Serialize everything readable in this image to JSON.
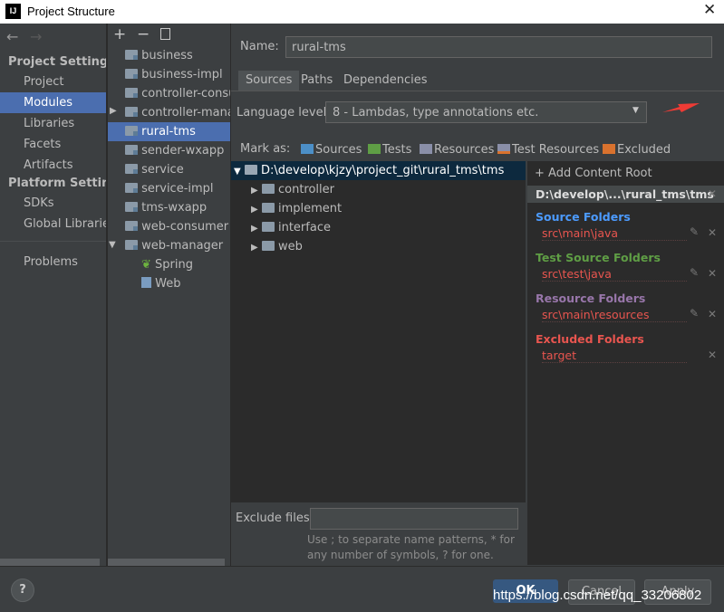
{
  "window": {
    "title": "Project Structure",
    "logo_text": "IJ"
  },
  "nav": {
    "project_settings": "Project Settings",
    "project_items": [
      "Project",
      "Modules",
      "Libraries",
      "Facets",
      "Artifacts"
    ],
    "platform_settings": "Platform Settings",
    "platform_items": [
      "SDKs",
      "Global Libraries"
    ],
    "problems": "Problems",
    "selected": "Modules"
  },
  "modules": {
    "items": [
      "business",
      "business-impl",
      "controller-consumer",
      "controller-manager",
      "rural-tms",
      "sender-wxapp",
      "service",
      "service-impl",
      "tms-wxapp",
      "web-consumer",
      "web-manager"
    ],
    "sub_items": [
      "Spring",
      "Web"
    ],
    "selected": "rural-tms"
  },
  "name_field": {
    "label": "Name:",
    "value": "rural-tms"
  },
  "tabs": [
    "Sources",
    "Paths",
    "Dependencies"
  ],
  "language_level": {
    "label": "Language level:",
    "value": "8 - Lambdas, type annotations etc."
  },
  "mark_as": {
    "label": "Mark as:",
    "items": [
      "Sources",
      "Tests",
      "Resources",
      "Test Resources",
      "Excluded"
    ],
    "colors": [
      "#4c8fc7",
      "#5f9e45",
      "#8a8fa8",
      "#8a8fa8",
      "#d9722e"
    ]
  },
  "tree": {
    "root": "D:\\develop\\kjzy\\project_git\\rural_tms\\tms",
    "children": [
      "controller",
      "implement",
      "interface",
      "web"
    ]
  },
  "content_root": {
    "add_label": "+ Add Content Root",
    "path": "D:\\develop\\...\\rural_tms\\tms",
    "sections": [
      {
        "heading": "Source Folders",
        "color": "#4c9bff",
        "path": "src\\main\\java"
      },
      {
        "heading": "Test Source Folders",
        "color": "#5f9e45",
        "path": "src\\test\\java"
      },
      {
        "heading": "Resource Folders",
        "color": "#9876aa",
        "path": "src\\main\\resources"
      },
      {
        "heading": "Excluded Folders",
        "color": "#e8554f",
        "path": "target"
      }
    ]
  },
  "exclude_files": {
    "label": "Exclude files:",
    "hint_line1": "Use ; to separate name patterns, * for",
    "hint_line2": "any number of symbols, ? for one."
  },
  "buttons": {
    "help": "?",
    "ok": "OK",
    "cancel": "Cancel",
    "apply": "Apply"
  },
  "watermark": "https://blog.csdn.net/qq_33206802",
  "accent_color": "#4b6eaf"
}
